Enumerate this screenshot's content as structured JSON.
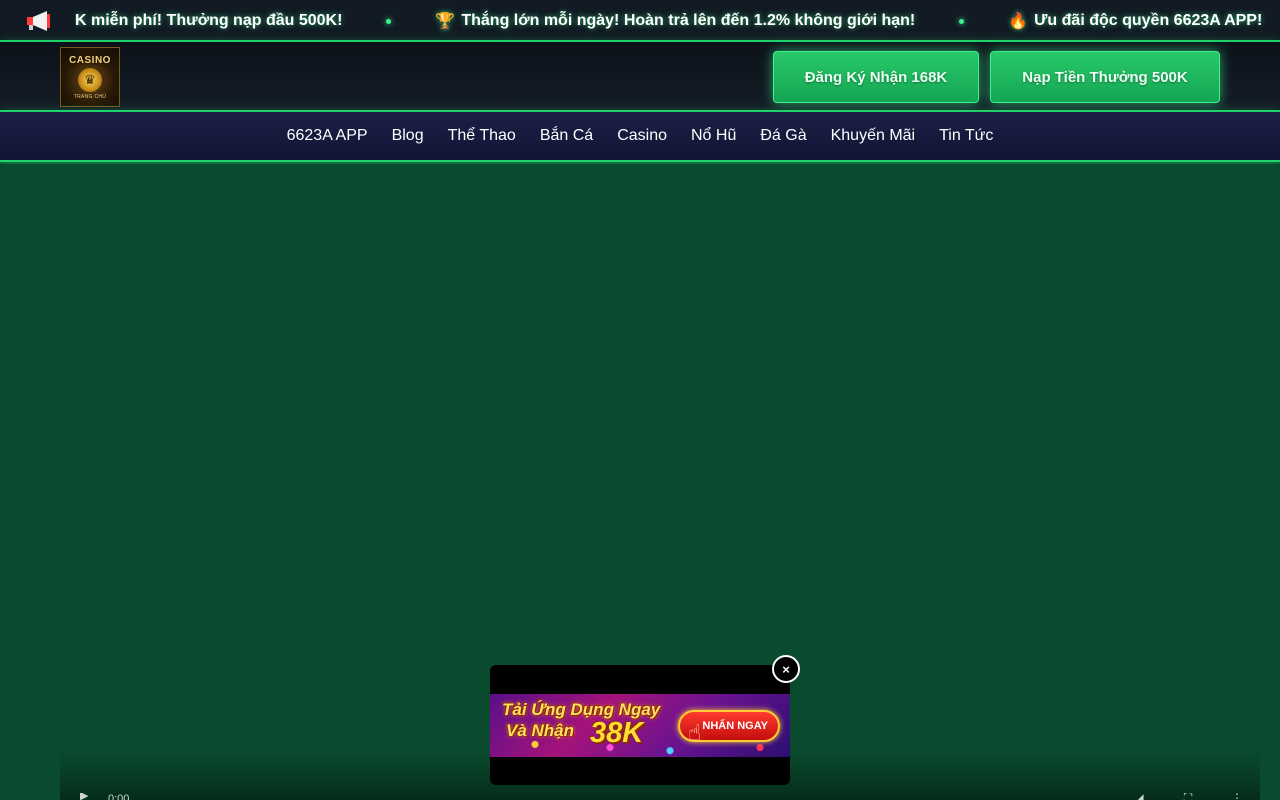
{
  "ticker": {
    "icon": "megaphone-icon",
    "items": [
      {
        "icon": "",
        "text": "K miễn phí! Thưởng nạp đầu 500K!"
      },
      {
        "icon": "🏆",
        "text": "Thắng lớn mỗi ngày! Hoàn trả lên đến 1.2% không giới hạn!"
      },
      {
        "icon": "🔥",
        "text": "Ưu đãi độc quyền 6623A APP!"
      }
    ]
  },
  "header": {
    "logo": {
      "top_text": "CASINO",
      "bottom_text": "TRANG CHỦ"
    },
    "register_button": "Đăng Ký Nhận 168K",
    "deposit_button": "Nạp Tiền Thưởng 500K"
  },
  "nav": {
    "items": [
      "6623A APP",
      "Blog",
      "Thể Thao",
      "Bắn Cá",
      "Casino",
      "Nổ Hũ",
      "Đá Gà",
      "Khuyến Mãi",
      "Tin Tức"
    ]
  },
  "video": {
    "time": "0:00"
  },
  "popup": {
    "line1": "Tải Ứng Dụng Ngay",
    "line2": "Và Nhận",
    "amount": "38K",
    "cta": "NHẤN NGAY",
    "close": "×"
  },
  "colors": {
    "accent_green": "#1fd36a",
    "page_bg": "#0a4a2e",
    "nav_bg": "#1b1f44",
    "ticker_bg": "#121a24"
  }
}
